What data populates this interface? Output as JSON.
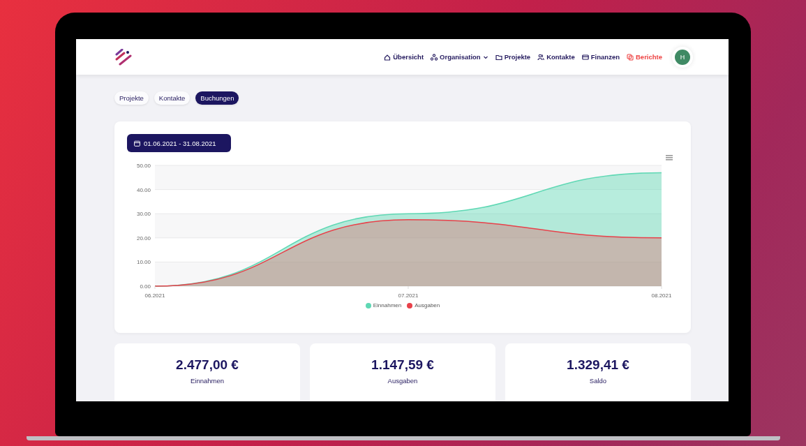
{
  "nav": {
    "items": [
      {
        "label": "Übersicht",
        "kind": "home",
        "selected": false
      },
      {
        "label": "Organisation",
        "kind": "org",
        "dropdown": true,
        "selected": false
      },
      {
        "label": "Projekte",
        "kind": "folder",
        "selected": false
      },
      {
        "label": "Kontakte",
        "kind": "people",
        "selected": false
      },
      {
        "label": "Finanzen",
        "kind": "card",
        "selected": false
      },
      {
        "label": "Berichte",
        "kind": "copy",
        "selected": true
      }
    ],
    "avatar": "H"
  },
  "tabs": [
    {
      "label": "Projekte",
      "selected": false
    },
    {
      "label": "Kontakte",
      "selected": false
    },
    {
      "label": "Buchungen",
      "selected": true
    }
  ],
  "date_range": "01.06.2021 - 31.08.2021",
  "chart_data": {
    "type": "area",
    "categories": [
      "06.2021",
      "07.2021",
      "08.2021"
    ],
    "ylim": [
      0,
      50
    ],
    "yticks": [
      {
        "value": 0,
        "label": "0.00"
      },
      {
        "value": 10,
        "label": "10.00"
      },
      {
        "value": 20,
        "label": "20.00"
      },
      {
        "value": 30,
        "label": "30.00"
      },
      {
        "value": 40,
        "label": "40.00"
      },
      {
        "value": 50,
        "label": "50.00"
      }
    ],
    "stacked": false,
    "grid": true,
    "series": [
      {
        "name": "Einnahmen",
        "color": "#5fd8b4",
        "values": [
          0,
          30,
          47
        ]
      },
      {
        "name": "Ausgaben",
        "color": "#e8414a",
        "values": [
          0,
          27.5,
          20
        ]
      }
    ]
  },
  "stats": [
    {
      "value": "2.477,00 €",
      "label": "Einnahmen"
    },
    {
      "value": "1.147,59 €",
      "label": "Ausgaben"
    },
    {
      "value": "1.329,41 €",
      "label": "Saldo"
    }
  ]
}
